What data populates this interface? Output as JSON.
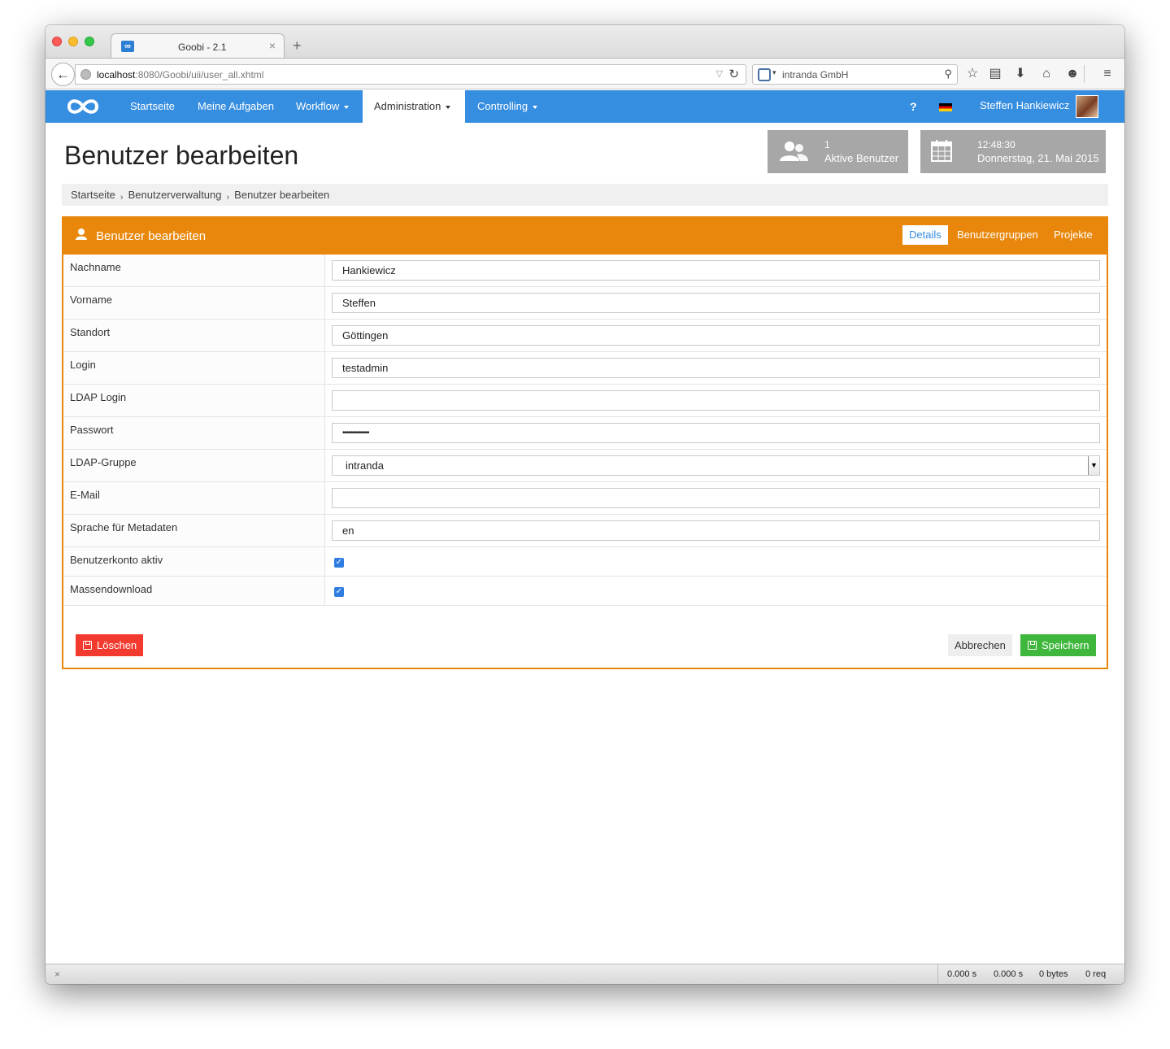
{
  "browser": {
    "tab_title": "Goobi - 2.1",
    "tab_favicon": "∞",
    "url_host": "localhost",
    "url_rest": ":8080/Goobi/uii/user_all.xhtml",
    "search_engine_text": "intranda GmbH",
    "toolbar_icons": [
      "star-icon",
      "reading-list-icon",
      "download-icon",
      "home-icon",
      "smiley-icon",
      "menu-icon"
    ]
  },
  "nav": {
    "items": [
      {
        "label": "Startseite"
      },
      {
        "label": "Meine Aufgaben"
      },
      {
        "label": "Workflow"
      },
      {
        "label": "Administration"
      },
      {
        "label": "Controlling"
      }
    ],
    "help": "?",
    "user_name": "Steffen Hankiewicz"
  },
  "page": {
    "title": "Benutzer bearbeiten"
  },
  "info": {
    "active_users_count": "1",
    "active_users_label": "Aktive Benutzer",
    "time": "12:48:30",
    "date": "Donnerstag, 21. Mai 2015"
  },
  "breadcrumb": [
    "Startseite",
    "Benutzerverwaltung",
    "Benutzer bearbeiten"
  ],
  "panel": {
    "title": "Benutzer bearbeiten",
    "tabs": [
      "Details",
      "Benutzergruppen",
      "Projekte"
    ]
  },
  "form": {
    "rows": [
      {
        "label": "Nachname",
        "value": "Hankiewicz"
      },
      {
        "label": "Vorname",
        "value": "Steffen"
      },
      {
        "label": "Standort",
        "value": "Göttingen"
      },
      {
        "label": "Login",
        "value": "testadmin"
      },
      {
        "label": "LDAP Login",
        "value": ""
      },
      {
        "label": "Passwort",
        "value": "•••••••••••••"
      },
      {
        "label": "LDAP-Gruppe",
        "value": "intranda"
      },
      {
        "label": "E-Mail",
        "value": ""
      },
      {
        "label": "Sprache für Metadaten",
        "value": "en"
      },
      {
        "label": "Benutzerkonto aktiv",
        "checked": true
      },
      {
        "label": "Massendownload",
        "checked": true
      }
    ]
  },
  "buttons": {
    "delete": "Löschen",
    "cancel": "Abbrechen",
    "save": "Speichern"
  },
  "statusbar": {
    "close": "×",
    "items": [
      "0.000 s",
      "0.000 s",
      "0 bytes",
      "0 req"
    ]
  },
  "colors": {
    "nav_blue": "#368ee0",
    "panel_orange": "#e8870b",
    "danger": "#f33a2e",
    "success": "#3fb73c",
    "info_gray": "#a7a7a7"
  }
}
